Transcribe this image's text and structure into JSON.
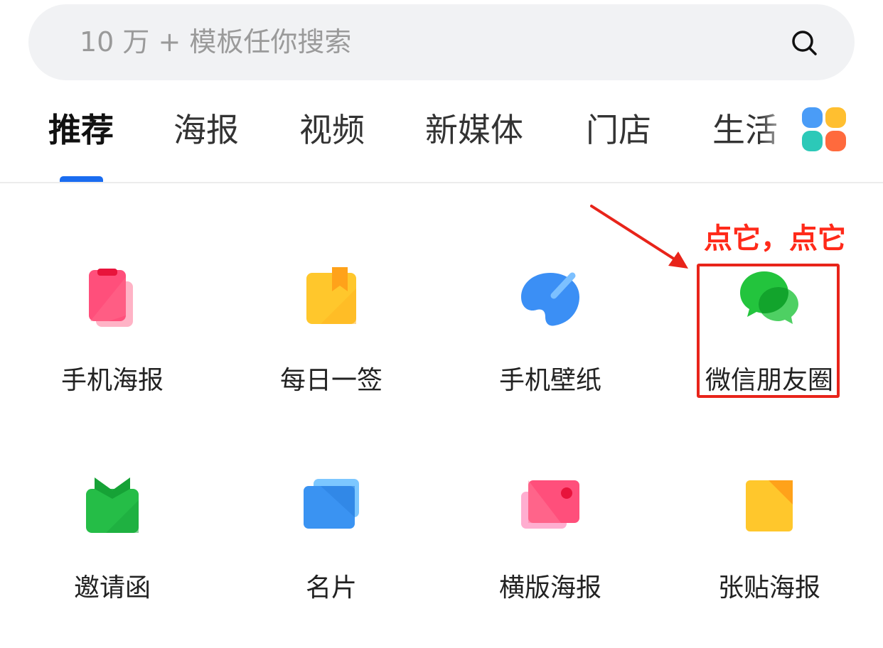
{
  "search": {
    "placeholder": "10 万 + 模板任你搜索",
    "icon": "search-icon"
  },
  "tabs": [
    {
      "label": "推荐",
      "active": true
    },
    {
      "label": "海报",
      "active": false
    },
    {
      "label": "视频",
      "active": false
    },
    {
      "label": "新媒体",
      "active": false
    },
    {
      "label": "门店",
      "active": false
    },
    {
      "label": "生活",
      "active": false
    }
  ],
  "more_tabs_icon": "grid-apps-icon",
  "accent_color": "#1a6cf0",
  "grid": [
    {
      "label": "手机海报",
      "icon": "phone-poster-icon"
    },
    {
      "label": "每日一签",
      "icon": "daily-sign-icon"
    },
    {
      "label": "手机壁纸",
      "icon": "palette-icon"
    },
    {
      "label": "微信朋友圈",
      "icon": "wechat-moments-icon"
    },
    {
      "label": "邀请函",
      "icon": "gift-invitation-icon"
    },
    {
      "label": "名片",
      "icon": "business-card-icon"
    },
    {
      "label": "横版海报",
      "icon": "landscape-poster-icon"
    },
    {
      "label": "张贴海报",
      "icon": "paste-poster-icon"
    }
  ],
  "annotation": {
    "text": "点它，点它",
    "color": "#e8241a"
  }
}
